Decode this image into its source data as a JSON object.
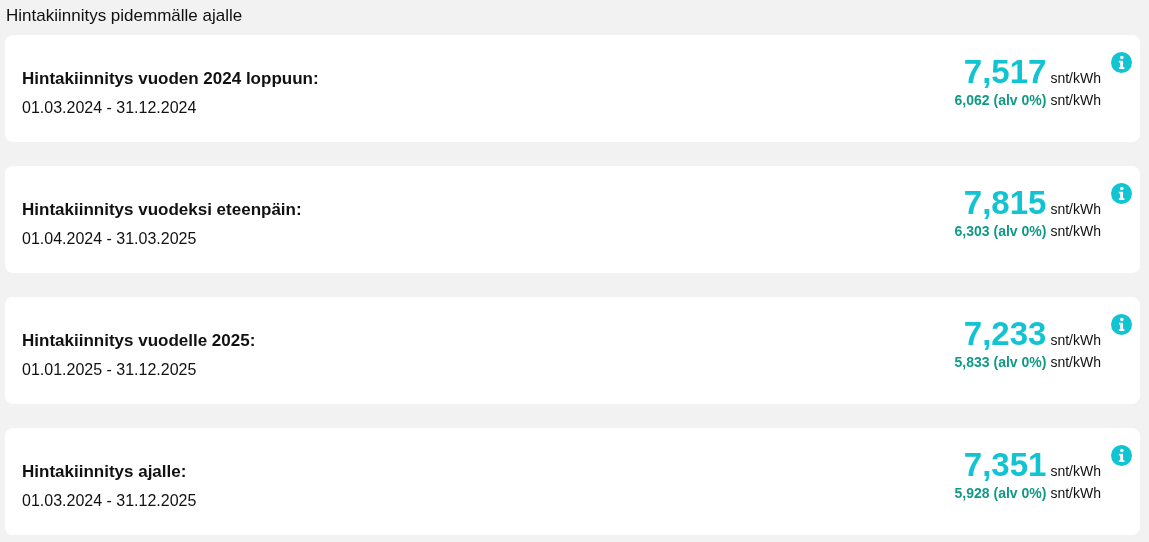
{
  "heading": "Hintakiinnitys pidemmälle ajalle",
  "offers": [
    {
      "title": "Hintakiinnitys vuoden 2024 loppuun:",
      "period": "01.03.2024 - 31.12.2024",
      "price": "7,517",
      "unit": "snt/kWh",
      "price_ex_vat": "6,062 (alv 0%)",
      "unit_ex_vat": "snt/kWh"
    },
    {
      "title": "Hintakiinnitys vuodeksi eteenpäin:",
      "period": "01.04.2024 - 31.03.2025",
      "price": "7,815",
      "unit": "snt/kWh",
      "price_ex_vat": "6,303 (alv 0%)",
      "unit_ex_vat": "snt/kWh"
    },
    {
      "title": "Hintakiinnitys vuodelle 2025:",
      "period": "01.01.2025 - 31.12.2025",
      "price": "7,233",
      "unit": "snt/kWh",
      "price_ex_vat": "5,833 (alv 0%)",
      "unit_ex_vat": "snt/kWh"
    },
    {
      "title": "Hintakiinnitys ajalle:",
      "period": "01.03.2024 - 31.12.2025",
      "price": "7,351",
      "unit": "snt/kWh",
      "price_ex_vat": "5,928 (alv 0%)",
      "unit_ex_vat": "snt/kWh"
    }
  ]
}
